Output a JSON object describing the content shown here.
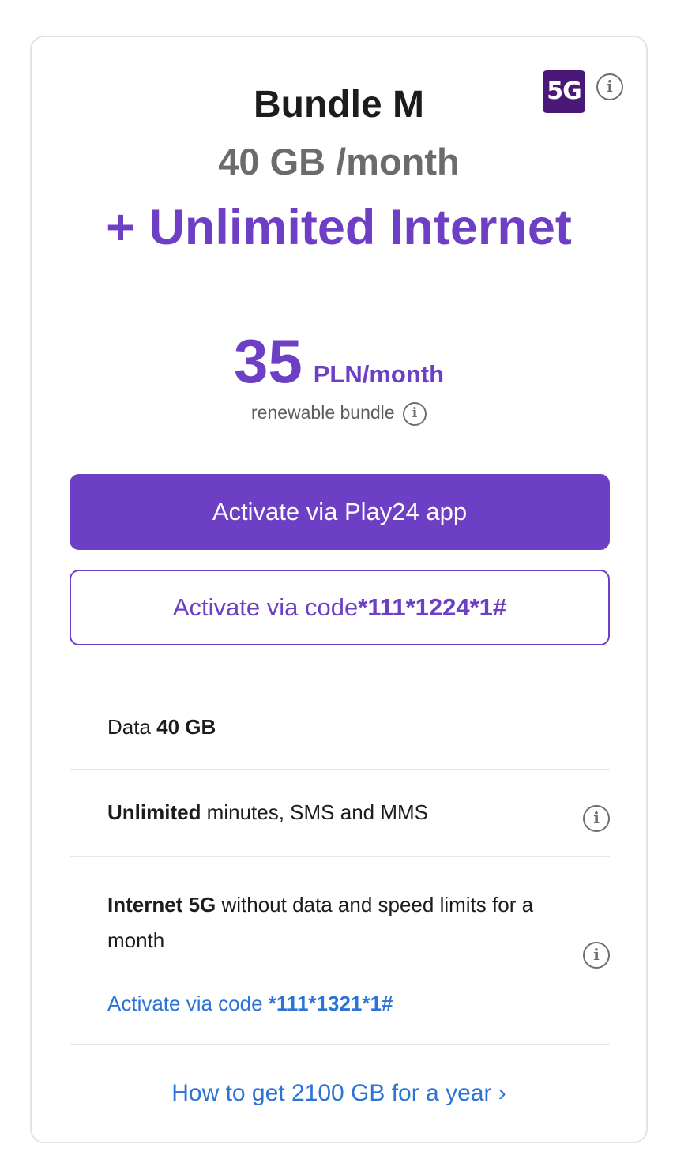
{
  "badge": {
    "label": "5G"
  },
  "offer": {
    "title": "Bundle M",
    "data_per_month": "40 GB /month",
    "extra": "+ Unlimited Internet",
    "price_amount": "35",
    "price_unit": "PLN/month",
    "renewable_label": "renewable bundle"
  },
  "buttons": {
    "activate_app": "Activate via Play24 app",
    "activate_code_prefix": "Activate via code",
    "activate_code_value": "*111*1224*1#"
  },
  "features": [
    {
      "label": "Data ",
      "bold": "40 GB",
      "rest": ""
    },
    {
      "bold": "Unlimited",
      "rest": " minutes, SMS and MMS"
    },
    {
      "bold_prefix": "Internet 5G",
      "rest": " without data and speed limits for a month",
      "link_prefix": "Activate via code ",
      "link_code": "*111*1321*1#"
    }
  ],
  "footer": {
    "howto_link": "How to get 2100 GB for a year ›"
  },
  "icons": {
    "info": "info-icon"
  },
  "colors": {
    "brand_purple": "#6c3fc4",
    "badge_purple": "#4a1877",
    "link_blue": "#2b73d6",
    "text_dark": "#1c1c1e",
    "text_gray": "#6b6b6e"
  }
}
